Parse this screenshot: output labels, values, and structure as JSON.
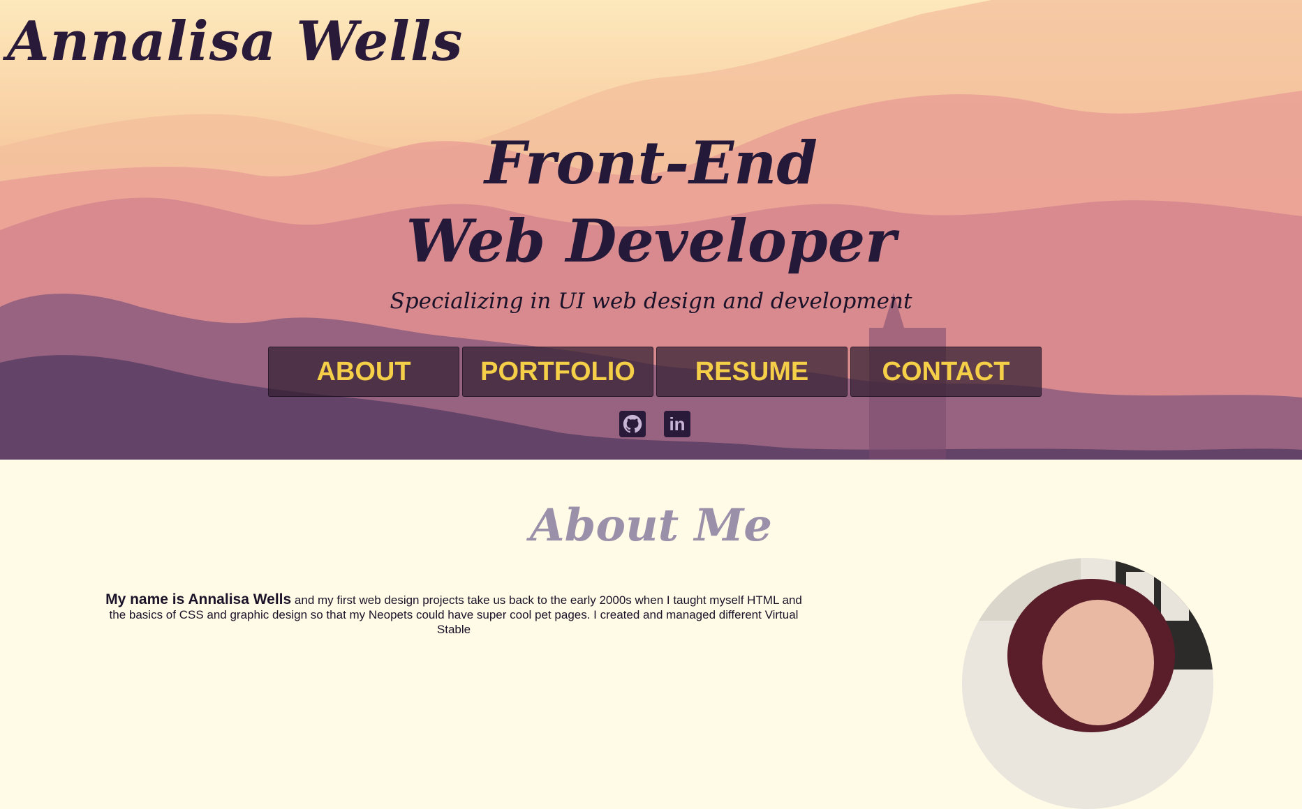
{
  "header": {
    "site_name": "Annalisa Wells"
  },
  "hero": {
    "headline_line1": "Front-End",
    "headline_line2": "Web Developer",
    "subtitle": "Specializing in UI web design and development"
  },
  "nav": {
    "items": [
      {
        "label": "ABOUT"
      },
      {
        "label": "PORTFOLIO"
      },
      {
        "label": "RESUME"
      },
      {
        "label": "CONTACT"
      }
    ]
  },
  "socials": [
    {
      "icon": "github-icon"
    },
    {
      "icon": "linkedin-icon",
      "glyph": "in"
    }
  ],
  "about": {
    "title": "About Me",
    "intro_bold": "My name is Annalisa Wells",
    "intro_rest": " and my first web design projects take us back to the early 2000s when I taught myself HTML and the basics of CSS and graphic design so that my Neopets could have super cool pet pages. I created and managed different Virtual Stable"
  },
  "colors": {
    "nav_text": "#f5cf47",
    "heading_dark": "#25193a",
    "about_title": "#9b90aa",
    "page_bg": "#fffbe6"
  }
}
